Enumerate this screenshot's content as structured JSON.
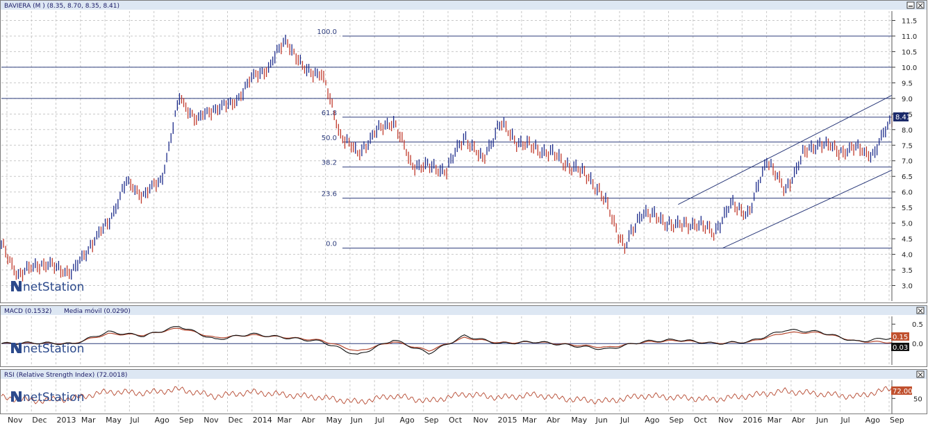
{
  "window": {
    "minimize_icon": "minimize-icon",
    "close_icon": "close-icon"
  },
  "logo": {
    "text": "netStation",
    "icon": "netstation-logo-icon"
  },
  "colors": {
    "price_up": "#1b2a8a",
    "price_down": "#c0392b",
    "macd": "#111111",
    "signal": "#b5472e",
    "rsi": "#b5472e",
    "grid": "#c8c8c8",
    "panel_header": "#dde7f3",
    "line": "#2b3a7a"
  },
  "chart_data": [
    {
      "panel": "price",
      "type": "line",
      "title": "BAVIERA (M ) (8.35, 8.70, 8.35, 8.41)",
      "last_value_label": "8.41",
      "ylim": [
        2.5,
        11.8
      ],
      "y_ticks": [
        "11.5",
        "11.0",
        "10.5",
        "10.0",
        "9.5",
        "9.0",
        "8.5",
        "8.0",
        "7.5",
        "7.0",
        "6.5",
        "6.0",
        "5.5",
        "5.0",
        "4.5",
        "4.0",
        "3.5",
        "3.0"
      ],
      "x_labels": [
        "Nov",
        "Dec",
        "2013",
        "Mar",
        "May",
        "Jul",
        "Ago",
        "Sep",
        "Nov",
        "Dec",
        "2014",
        "Mar",
        "Abr",
        "May",
        "Jun",
        "Jul",
        "Ago",
        "Sep",
        "Oct",
        "Nov",
        "2015",
        "Mar",
        "Abr",
        "May",
        "Jun",
        "Jul",
        "Ago",
        "Sep",
        "Oct",
        "Nov",
        "2016",
        "Mar",
        "Abr",
        "Jun",
        "Jul",
        "Ago",
        "Sep"
      ],
      "fibonacci": [
        {
          "label": "100.0",
          "value": 11.0
        },
        {
          "label": "61.8",
          "value": 8.4
        },
        {
          "label": "50.0",
          "value": 7.6
        },
        {
          "label": "38.2",
          "value": 6.8
        },
        {
          "label": "23.6",
          "value": 5.8
        },
        {
          "label": "0.0",
          "value": 4.2
        }
      ],
      "horizontal_levels": [
        10.0,
        9.0
      ],
      "x": [
        0,
        2,
        4,
        6,
        8,
        10,
        12,
        14,
        16,
        18,
        20,
        22,
        24,
        26,
        28,
        30,
        32,
        34,
        36,
        38,
        40,
        42,
        44,
        46,
        48,
        50,
        52,
        54,
        56,
        58,
        60,
        62,
        64,
        66,
        68,
        70,
        72,
        74,
        76,
        78,
        80,
        82,
        84,
        86,
        88,
        90,
        92,
        94,
        96,
        98,
        100
      ],
      "close": [
        4.3,
        3.3,
        3.7,
        3.6,
        3.4,
        4.3,
        5.0,
        6.3,
        5.9,
        6.4,
        9.0,
        8.3,
        8.7,
        8.8,
        9.6,
        10.0,
        10.9,
        9.9,
        9.8,
        7.9,
        7.2,
        7.9,
        8.3,
        6.9,
        6.8,
        6.7,
        7.8,
        7.0,
        8.2,
        7.6,
        7.4,
        7.2,
        6.8,
        6.5,
        5.6,
        4.2,
        5.4,
        5.1,
        4.9,
        5.0,
        4.7,
        5.6,
        5.3,
        7.1,
        6.0,
        7.2,
        7.6,
        7.3,
        7.4,
        7.2,
        8.41
      ],
      "channel": {
        "upper": [
          [
            76,
            5.6
          ],
          [
            100,
            9.1
          ]
        ],
        "lower": [
          [
            81,
            4.2
          ],
          [
            100,
            6.7
          ]
        ]
      }
    },
    {
      "panel": "macd",
      "type": "line",
      "title": "MACD (0.1532)",
      "signal_label": "Media móvil (0.0290)",
      "tag_macd": "0.15",
      "tag_signal": "0.03",
      "ylim": [
        -0.55,
        0.7
      ],
      "y_ticks": [
        "0.5",
        "0.0"
      ],
      "x": [
        0,
        4,
        8,
        12,
        16,
        20,
        24,
        28,
        32,
        36,
        40,
        44,
        48,
        52,
        56,
        60,
        64,
        68,
        72,
        76,
        80,
        84,
        88,
        92,
        96,
        100
      ],
      "macd": [
        0.0,
        0.02,
        -0.01,
        0.3,
        0.2,
        0.45,
        0.1,
        0.25,
        0.15,
        0.05,
        -0.3,
        0.1,
        -0.25,
        0.2,
        0.0,
        0.05,
        -0.05,
        -0.15,
        0.05,
        0.1,
        0.0,
        0.05,
        0.35,
        0.3,
        0.05,
        0.15
      ],
      "signal": [
        0.0,
        0.01,
        0.0,
        0.25,
        0.22,
        0.4,
        0.15,
        0.22,
        0.16,
        0.08,
        -0.2,
        0.05,
        -0.18,
        0.15,
        0.02,
        0.04,
        -0.03,
        -0.1,
        0.03,
        0.08,
        0.01,
        0.04,
        0.28,
        0.28,
        0.06,
        0.03
      ]
    },
    {
      "panel": "rsi",
      "type": "line",
      "title": "RSI (Relative Strength Index) (72.0018)",
      "tag_rsi": "72.00",
      "ylim": [
        20,
        90
      ],
      "y_ticks": [
        "50"
      ],
      "x": [
        0,
        4,
        8,
        12,
        16,
        20,
        24,
        28,
        32,
        36,
        40,
        44,
        48,
        52,
        56,
        60,
        64,
        68,
        72,
        76,
        80,
        84,
        88,
        92,
        96,
        100
      ],
      "rsi": [
        52,
        45,
        50,
        65,
        62,
        70,
        55,
        64,
        58,
        52,
        42,
        56,
        44,
        60,
        52,
        58,
        48,
        44,
        56,
        52,
        48,
        56,
        66,
        60,
        54,
        72
      ]
    }
  ]
}
